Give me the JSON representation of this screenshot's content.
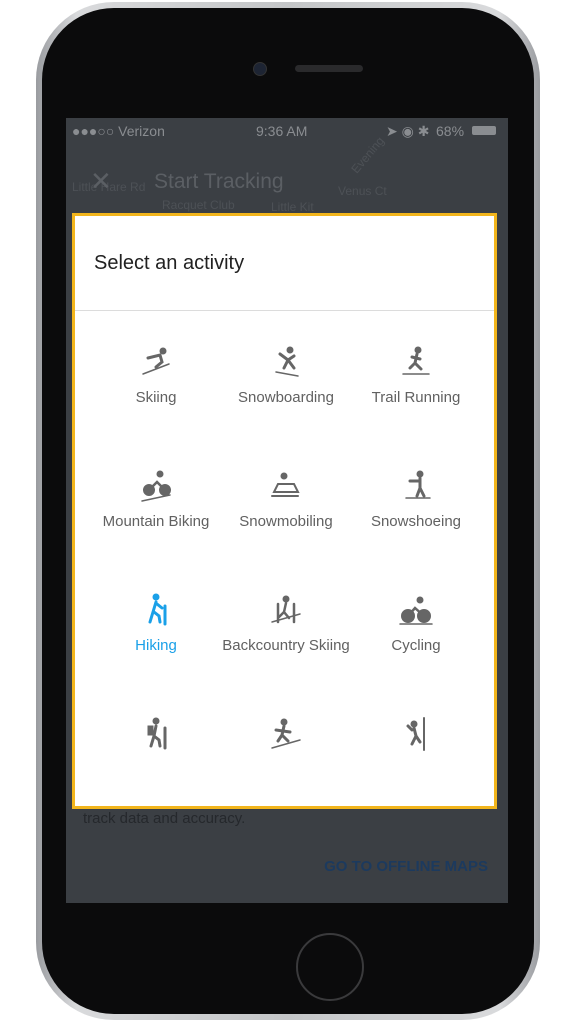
{
  "status_bar": {
    "carrier": "●●●○○ Verizon",
    "time": "9:36 AM",
    "battery": "68%"
  },
  "background": {
    "title": "Start Tracking",
    "map_labels": [
      "Little Hare Rd",
      "Racquet Club",
      "Little Kit",
      "Venus Ct",
      "Evening"
    ],
    "body_text": "track data and accuracy.",
    "offline_button": "GO TO OFFLINE MAPS"
  },
  "modal": {
    "title": "Select an activity",
    "accent_color": "#1aa0e8",
    "activities": [
      {
        "label": "Skiing",
        "icon": "skiing-icon"
      },
      {
        "label": "Snowboarding",
        "icon": "snowboarding-icon"
      },
      {
        "label": "Trail Running",
        "icon": "trail-running-icon"
      },
      {
        "label": "Mountain Biking",
        "icon": "mountain-biking-icon"
      },
      {
        "label": "Snowmobiling",
        "icon": "snowmobile-icon"
      },
      {
        "label": "Snowshoeing",
        "icon": "snowshoeing-icon"
      },
      {
        "label": "Hiking",
        "icon": "hiking-icon",
        "selected": true
      },
      {
        "label": "Backcountry Skiing",
        "icon": "backcountry-skiing-icon"
      },
      {
        "label": "Cycling",
        "icon": "cycling-icon"
      },
      {
        "label": "",
        "icon": "backpacking-icon"
      },
      {
        "label": "",
        "icon": "ski-touring-icon"
      },
      {
        "label": "",
        "icon": "climbing-icon"
      }
    ]
  }
}
